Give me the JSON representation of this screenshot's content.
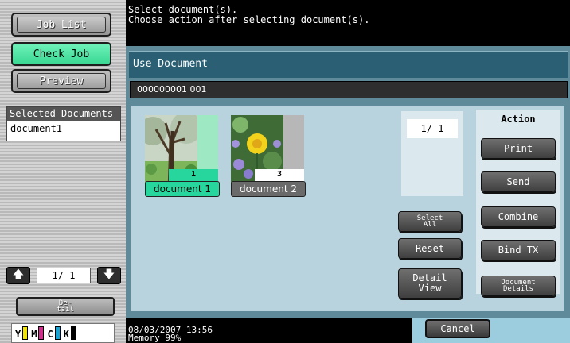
{
  "left": {
    "job_list": "Job List",
    "check_job": "Check Job",
    "preview": "Preview",
    "selected_header": "Selected Documents",
    "selected_items": [
      "document1"
    ],
    "page_indicator": "1/  1",
    "detail_label": "De-\ntail",
    "toner": [
      {
        "label": "Y",
        "color": "#f2e600"
      },
      {
        "label": "M",
        "color": "#d22c8c"
      },
      {
        "label": "C",
        "color": "#12a5d8"
      },
      {
        "label": "K",
        "color": "#000000"
      }
    ]
  },
  "message": {
    "line1": "Select document(s).",
    "line2": "Choose action after selecting document(s)."
  },
  "panel": {
    "title": "Use Document",
    "box_info": "000000001   001",
    "documents": [
      {
        "label": "document 1",
        "pages": "1",
        "selected": true
      },
      {
        "label": "document 2",
        "pages": "3",
        "selected": false
      }
    ],
    "doc_count": "1/  1",
    "select_all": "Select\nAll",
    "reset": "Reset",
    "detail_view": "Detail\nView",
    "action_header": "Action",
    "actions": {
      "print": "Print",
      "send": "Send",
      "combine": "Combine",
      "bind_tx": "Bind TX",
      "document_details": "Document\nDetails"
    }
  },
  "status": {
    "datetime": "08/03/2007    13:56",
    "memory": "Memory          99%",
    "cancel": "Cancel"
  }
}
